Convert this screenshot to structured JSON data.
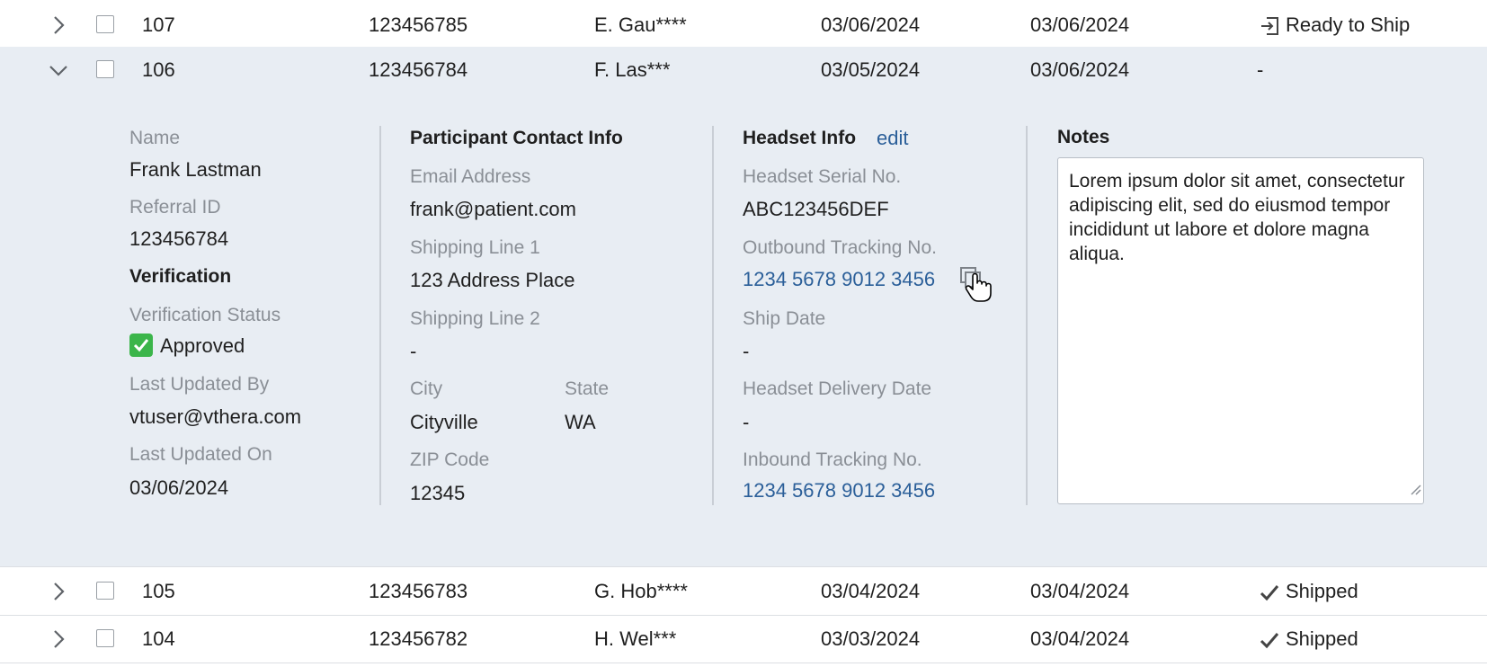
{
  "rows": [
    {
      "id": "107",
      "referral": "123456785",
      "name": "E. Gau****",
      "date1": "03/06/2024",
      "date2": "03/06/2024",
      "status": "Ready to Ship",
      "status_icon": "ready-to-ship-icon"
    },
    {
      "id": "106",
      "referral": "123456784",
      "name": "F. Las***",
      "date1": "03/05/2024",
      "date2": "03/06/2024",
      "status": "-",
      "status_icon": ""
    },
    {
      "id": "105",
      "referral": "123456783",
      "name": "G. Hob****",
      "date1": "03/04/2024",
      "date2": "03/04/2024",
      "status": "Shipped",
      "status_icon": "checkmark-icon"
    },
    {
      "id": "104",
      "referral": "123456782",
      "name": "H. Wel***",
      "date1": "03/03/2024",
      "date2": "03/04/2024",
      "status": "Shipped",
      "status_icon": "checkmark-icon"
    }
  ],
  "detail": {
    "participant": {
      "name_label": "Name",
      "name_value": "Frank Lastman",
      "referral_label": "Referral ID",
      "referral_value": "123456784",
      "verification_heading": "Verification",
      "verification_status_label": "Verification Status",
      "verification_status_value": "Approved",
      "updated_by_label": "Last Updated By",
      "updated_by_value": "vtuser@vthera.com",
      "updated_on_label": "Last Updated On",
      "updated_on_value": "03/06/2024"
    },
    "contact": {
      "heading": "Participant Contact Info",
      "email_label": "Email Address",
      "email_value": "frank@patient.com",
      "ship1_label": "Shipping Line 1",
      "ship1_value": "123 Address Place",
      "ship2_label": "Shipping Line 2",
      "ship2_value": "-",
      "city_label": "City",
      "city_value": "Cityville",
      "state_label": "State",
      "state_value": "WA",
      "zip_label": "ZIP Code",
      "zip_value": "12345"
    },
    "headset": {
      "heading": "Headset Info",
      "edit_label": "edit",
      "serial_label": "Headset Serial No.",
      "serial_value": "ABC123456DEF",
      "outbound_label": "Outbound Tracking No.",
      "outbound_value": "1234 5678 9012 3456",
      "ship_date_label": "Ship Date",
      "ship_date_value": "-",
      "delivery_label": "Headset Delivery Date",
      "delivery_value": "-",
      "inbound_label": "Inbound Tracking No.",
      "inbound_value": "1234 5678 9012 3456"
    },
    "notes": {
      "heading": "Notes",
      "text": "Lorem ipsum dolor sit amet, consectetur adipiscing elit, sed do eiusmod tempor incididunt ut labore et dolore magna aliqua."
    }
  },
  "colors": {
    "accent_link": "#2b5f99",
    "expanded_bg": "#e8edf3",
    "approved_green": "#3bb54a"
  }
}
